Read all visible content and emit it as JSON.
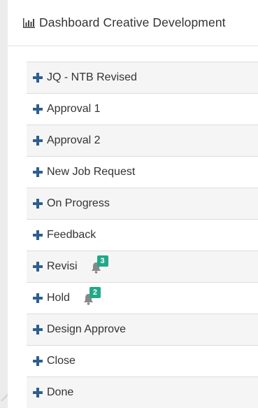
{
  "colors": {
    "accent_blue": "#2d5f8f",
    "badge_green": "#22a888",
    "row_alt": "#f5f5f5",
    "divider": "#dcdcdc"
  },
  "header": {
    "icon": "bar-chart-icon",
    "title": "Dashboard Creative Development"
  },
  "items": [
    {
      "label": "JQ - NTB Revised",
      "icon": "plus-icon"
    },
    {
      "label": "Approval 1",
      "icon": "plus-icon"
    },
    {
      "label": "Approval 2",
      "icon": "plus-icon"
    },
    {
      "label": "New Job Request",
      "icon": "plus-icon"
    },
    {
      "label": "On Progress",
      "icon": "plus-icon"
    },
    {
      "label": "Feedback",
      "icon": "plus-icon"
    },
    {
      "label": "Revisi",
      "icon": "plus-icon",
      "notification_icon": "bell-icon",
      "badge": "3"
    },
    {
      "label": "Hold",
      "icon": "plus-icon",
      "notification_icon": "bell-icon",
      "badge": "2"
    },
    {
      "label": "Design Approve",
      "icon": "plus-icon"
    },
    {
      "label": "Close",
      "icon": "plus-icon"
    },
    {
      "label": "Done",
      "icon": "plus-icon"
    }
  ]
}
